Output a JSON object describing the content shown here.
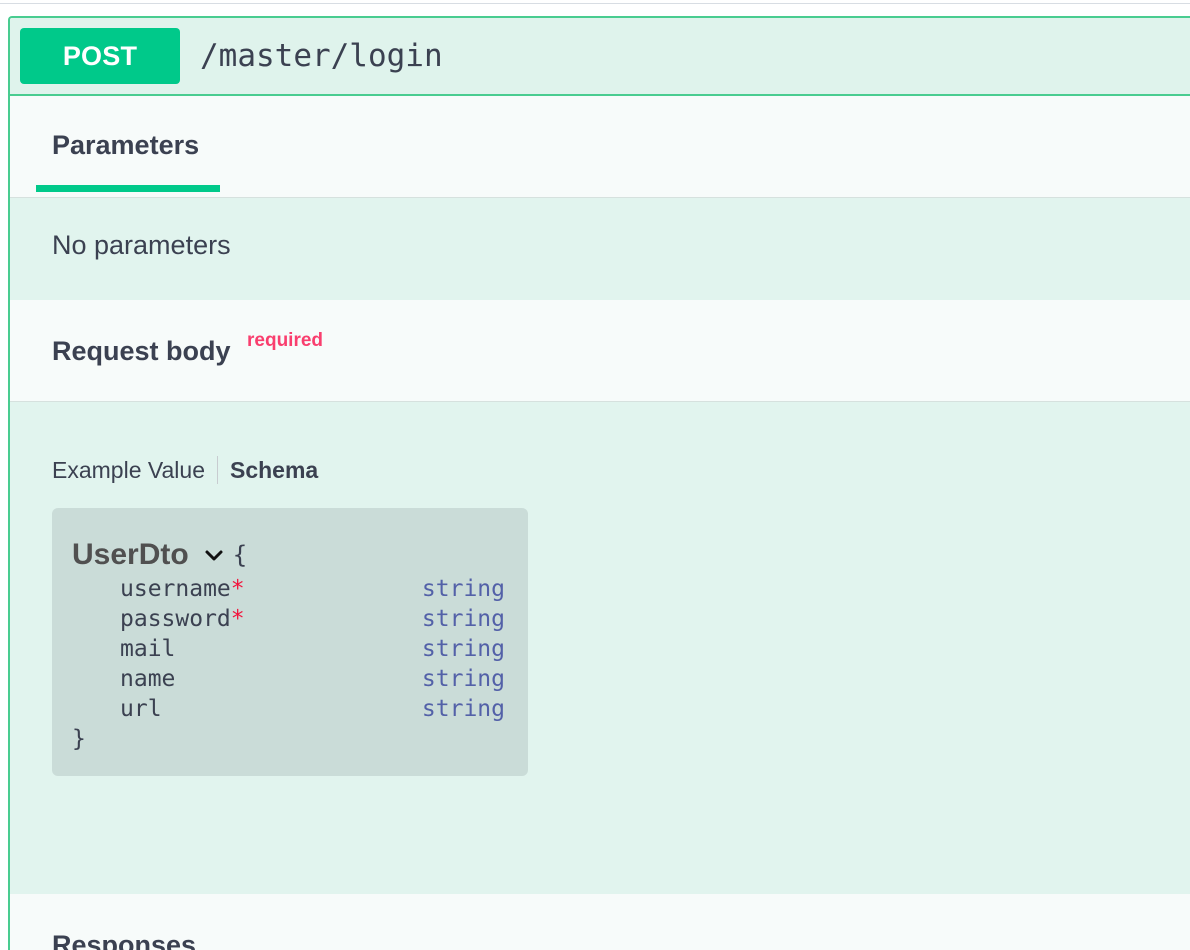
{
  "operation": {
    "method": "POST",
    "path": "/master/login",
    "method_color": "#00c98a",
    "accent_border": "#49cc90"
  },
  "tabs": {
    "parameters_label": "Parameters"
  },
  "parameters": {
    "empty_text": "No parameters"
  },
  "request_body": {
    "title": "Request body",
    "required_label": "required",
    "view_tabs": {
      "example_label": "Example Value",
      "schema_label": "Schema",
      "active": "Schema"
    },
    "model": {
      "name": "UserDto",
      "expand_icon": "chevron-down-icon",
      "open_brace": "{",
      "close_brace": "}",
      "properties": [
        {
          "name": "username",
          "required": "*",
          "type": "string"
        },
        {
          "name": "password",
          "required": "*",
          "type": "string"
        },
        {
          "name": "mail",
          "required": "",
          "type": "string"
        },
        {
          "name": "name",
          "required": "",
          "type": "string"
        },
        {
          "name": "url",
          "required": "",
          "type": "string"
        }
      ]
    }
  },
  "responses": {
    "title": "Responses"
  }
}
